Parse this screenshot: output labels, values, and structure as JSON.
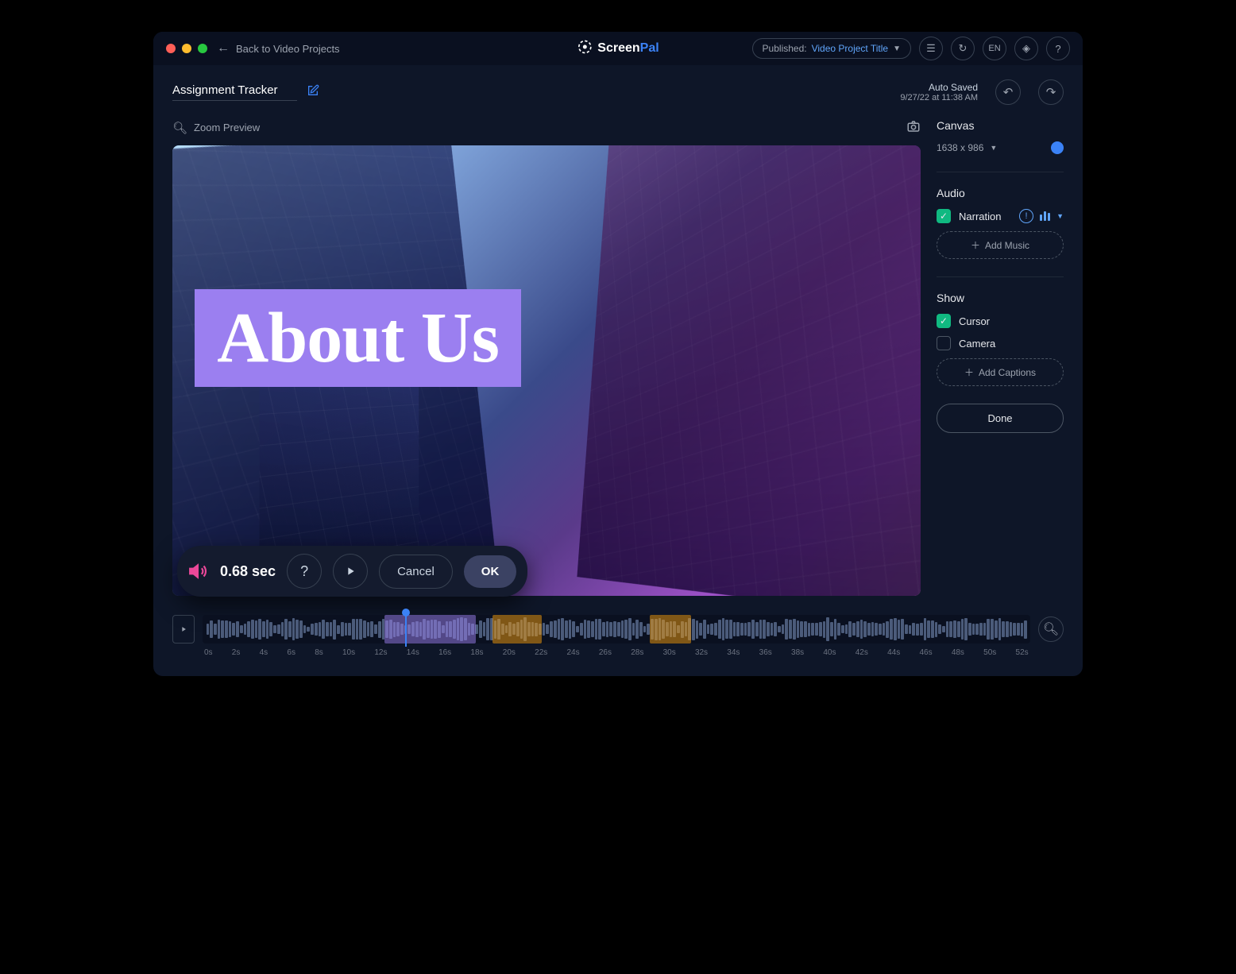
{
  "titlebar": {
    "back_label": "Back to Video Projects",
    "logo_screen": "Screen",
    "logo_pal": "Pal",
    "publish_label": "Published:",
    "publish_value": "Video Project Title",
    "lang": "EN"
  },
  "project": {
    "title": "Assignment Tracker",
    "autosaved_label": "Auto Saved",
    "autosaved_time": "9/27/22 at 11:38 AM"
  },
  "preview": {
    "zoom_label": "Zoom Preview",
    "overlay_text": "About Us"
  },
  "sidebar": {
    "canvas_title": "Canvas",
    "canvas_size": "1638 x 986",
    "audio_title": "Audio",
    "narration_label": "Narration",
    "add_music": "Add Music",
    "show_title": "Show",
    "cursor_label": "Cursor",
    "camera_label": "Camera",
    "add_captions": "Add Captions",
    "done": "Done"
  },
  "float": {
    "time": "0.68 sec",
    "cancel": "Cancel",
    "ok": "OK"
  },
  "timeline": {
    "ticks": [
      "0s",
      "2s",
      "4s",
      "6s",
      "8s",
      "10s",
      "12s",
      "14s",
      "16s",
      "18s",
      "20s",
      "22s",
      "24s",
      "26s",
      "28s",
      "30s",
      "32s",
      "34s",
      "36s",
      "38s",
      "40s",
      "42s",
      "44s",
      "46s",
      "48s",
      "50s",
      "52s"
    ]
  }
}
